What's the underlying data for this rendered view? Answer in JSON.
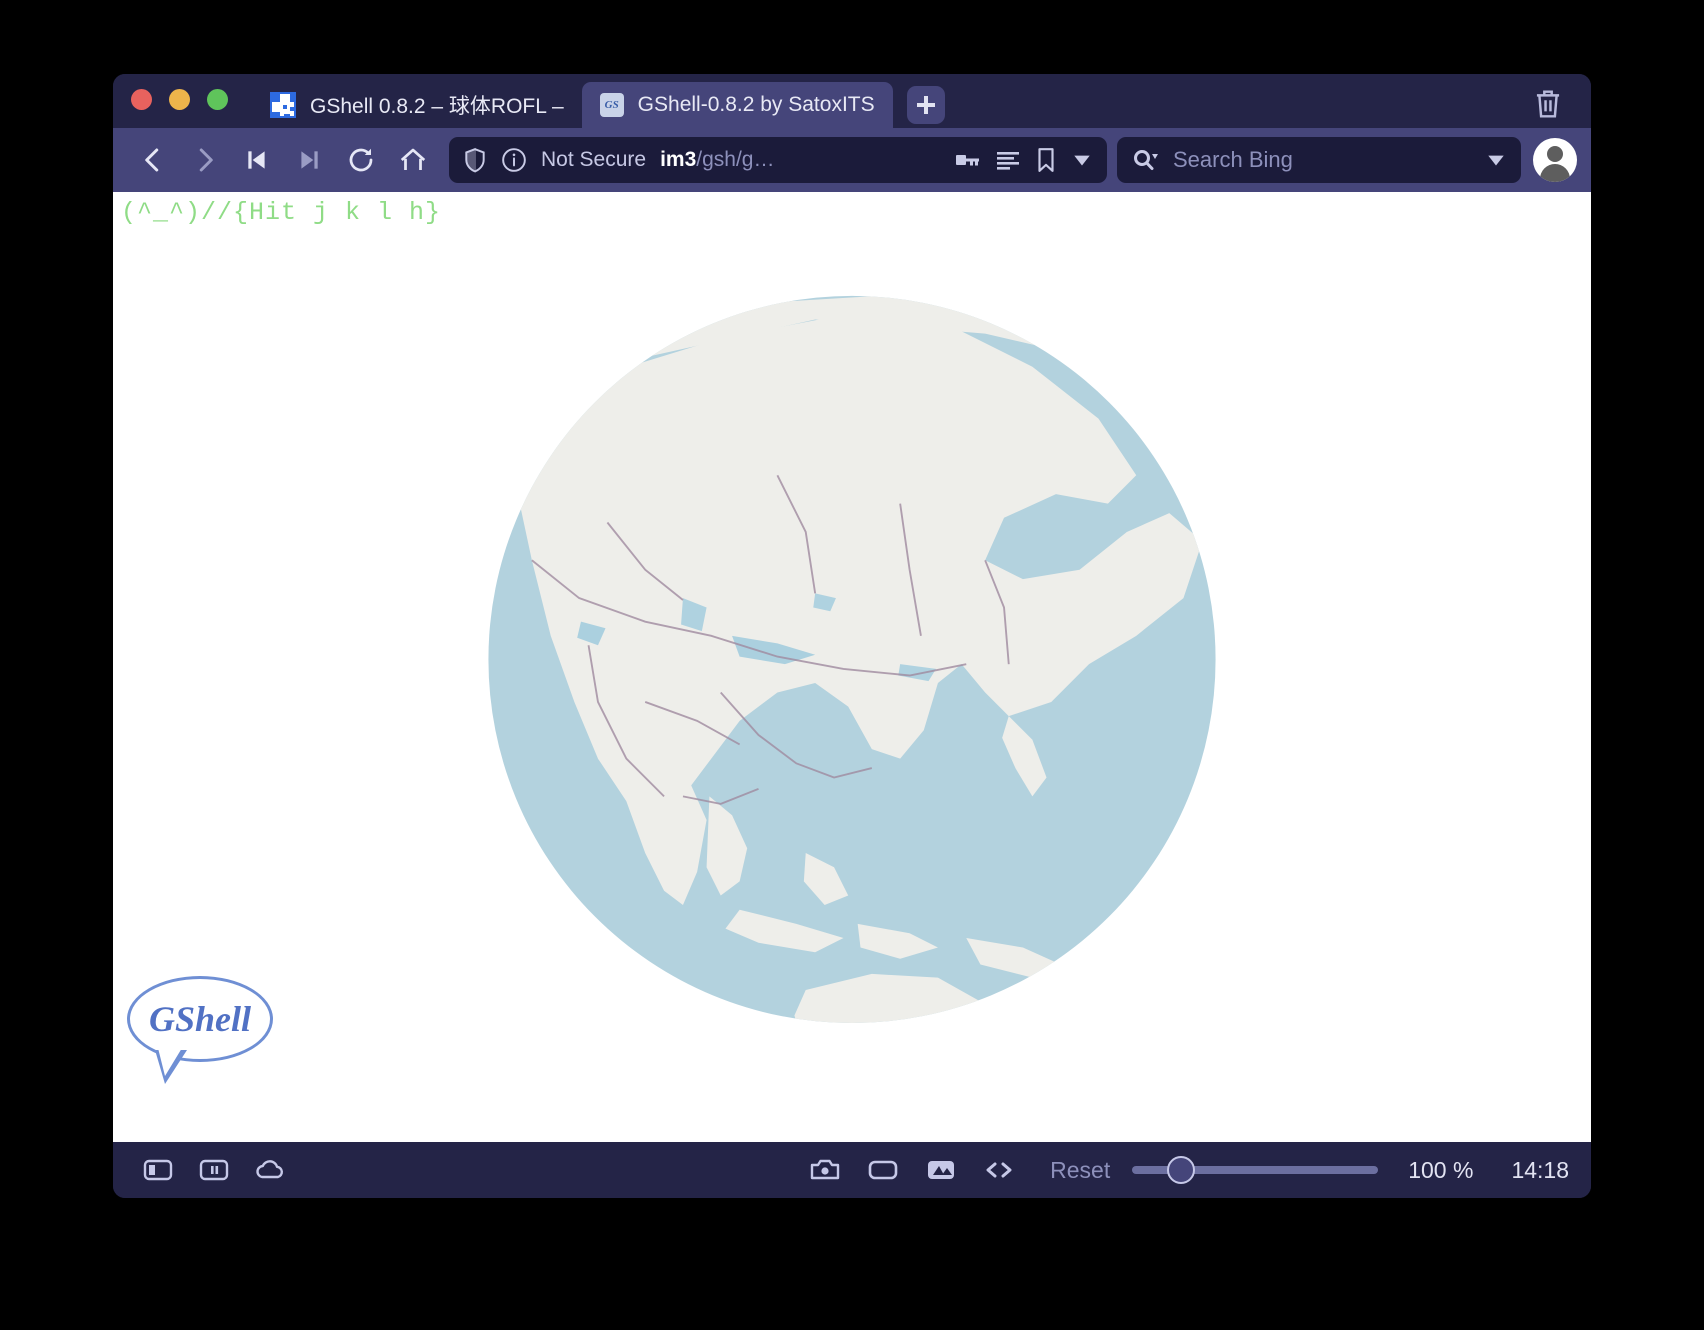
{
  "window": {
    "traffic_lights": [
      {
        "name": "close",
        "color": "#e8625e"
      },
      {
        "name": "minimize",
        "color": "#edb44b"
      },
      {
        "name": "maximize",
        "color": "#5fc45b"
      }
    ]
  },
  "tabs": [
    {
      "label": "GShell 0.8.2 – 球体ROFL –",
      "favicon": "qr-code-icon",
      "active": false
    },
    {
      "label": "GShell-0.8.2 by SatoxITS",
      "favicon": "gshell-icon",
      "active": true
    }
  ],
  "tabbar": {
    "new_tab_label": "+",
    "new_tab_icon": "plus-icon",
    "trash_icon": "trash-icon"
  },
  "toolbar": {
    "back_icon": "back-arrow-icon",
    "forward_icon": "forward-arrow-icon",
    "first_icon": "skip-to-start-icon",
    "last_icon": "skip-to-end-icon",
    "reload_icon": "reload-icon",
    "home_icon": "home-icon",
    "shield_icon": "shield-icon",
    "info_icon": "info-icon",
    "security_label": "Not Secure",
    "url_host": "im3",
    "url_path": "/gsh/g…",
    "key_icon": "key-icon",
    "reader_icon": "reader-view-icon",
    "bookmark_icon": "bookmark-icon",
    "dropdown_icon": "chevron-down-icon",
    "search_icon": "search-icon",
    "search_placeholder": "Search Bing",
    "search_value": "",
    "search_dropdown_icon": "chevron-down-icon",
    "avatar_icon": "user-avatar-icon"
  },
  "page": {
    "hint_text": "(^_^)//{Hit j k l h}",
    "hint_color": "#8fdc86",
    "logo_text": "GShell",
    "logo_color": "#5171c4",
    "globe": {
      "ocean_color": "#b3d2de",
      "land_color": "#eeeeea",
      "border_color": "#a08ba0"
    }
  },
  "statusbar": {
    "sidebar_icon": "sidebar-toggle-icon",
    "split_icon": "split-view-icon",
    "cloud_icon": "cloud-icon",
    "camera_icon": "camera-icon",
    "frame_icon": "frame-icon",
    "image_icon": "image-icon",
    "code_icon": "code-brackets-icon",
    "reset_label": "Reset",
    "zoom_slider_value": 20,
    "zoom_label": "100 %",
    "clock": "14:18"
  }
}
